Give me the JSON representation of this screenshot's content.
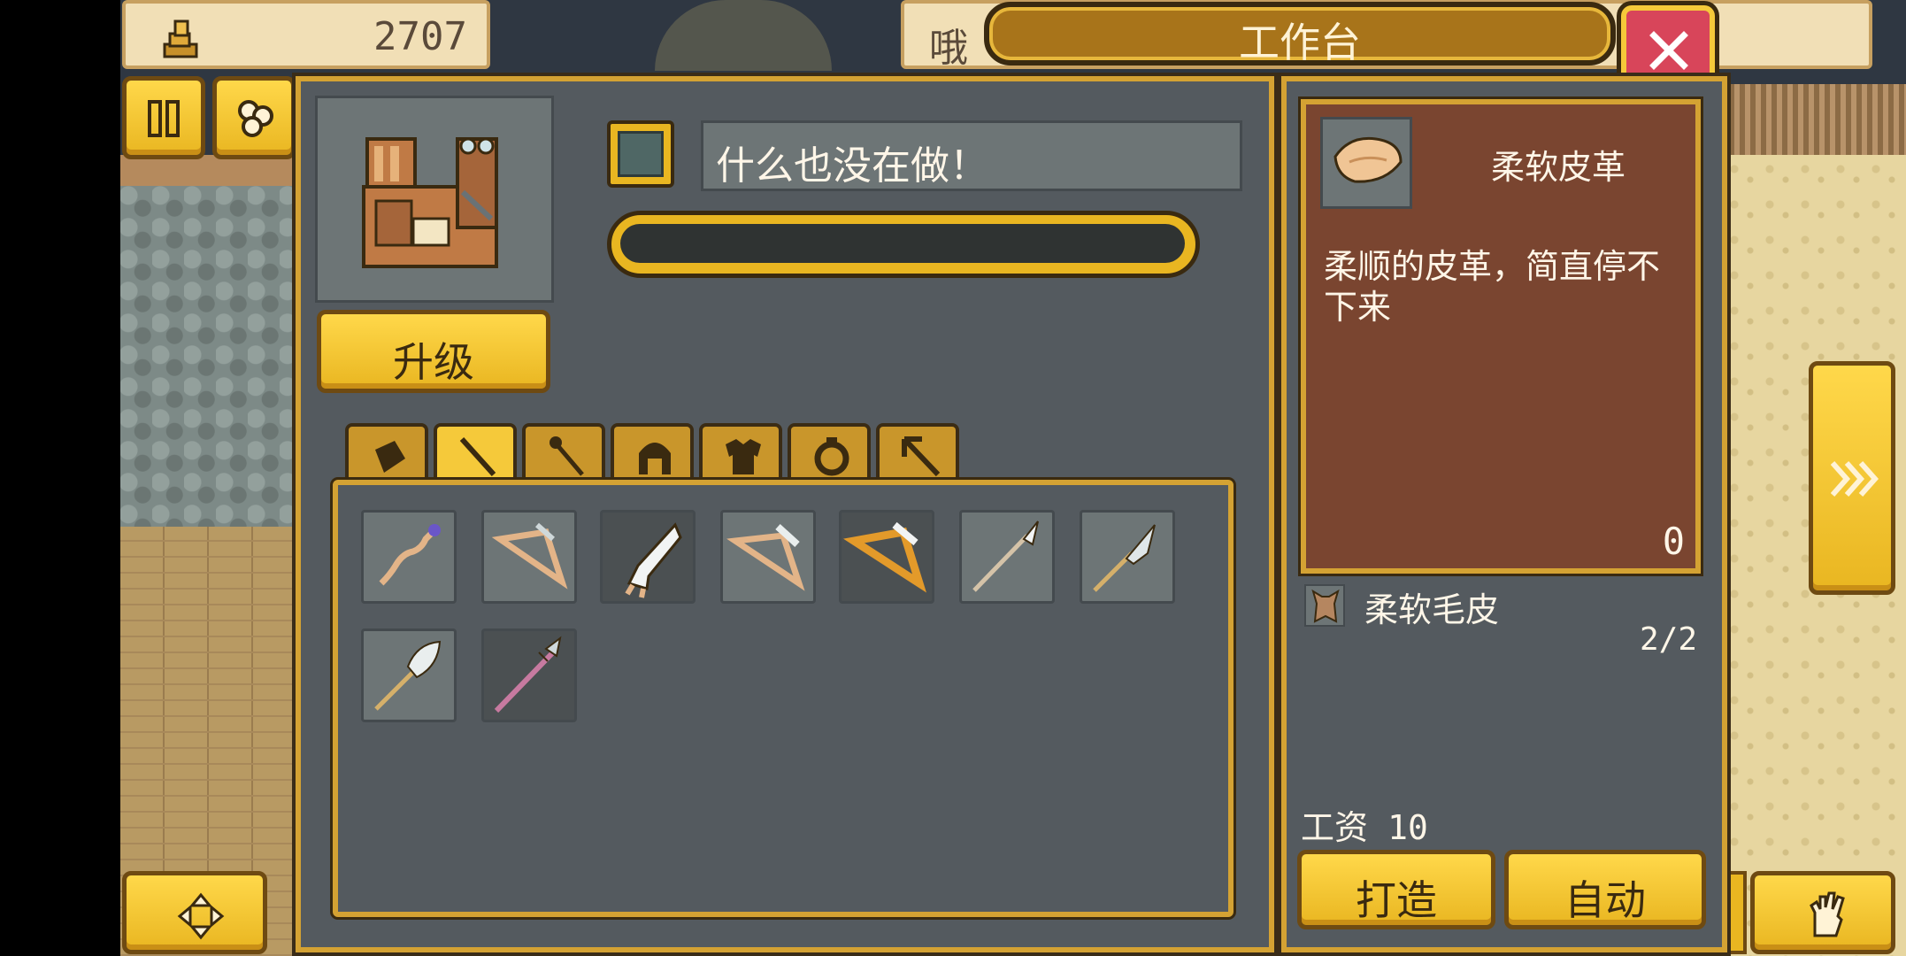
{
  "header": {
    "coins": "2707",
    "partial_label": "哦",
    "title": "工作台"
  },
  "workbench": {
    "status_text": "什么也没在做！",
    "progress": 0,
    "upgrade_label": "升级"
  },
  "tabs": [
    {
      "icon": "material-icon",
      "active": false
    },
    {
      "icon": "staff-icon",
      "active": true
    },
    {
      "icon": "wand-icon",
      "active": false
    },
    {
      "icon": "helmet-icon",
      "active": false
    },
    {
      "icon": "armor-icon",
      "active": false
    },
    {
      "icon": "ring-icon",
      "active": false
    },
    {
      "icon": "pickaxe-icon",
      "active": false
    }
  ],
  "recipes": [
    {
      "icon": "twisted-staff-icon"
    },
    {
      "icon": "bow-icon"
    },
    {
      "icon": "claw-blade-icon"
    },
    {
      "icon": "bow-icon"
    },
    {
      "icon": "golden-bow-icon"
    },
    {
      "icon": "spear-icon"
    },
    {
      "icon": "glaive-icon"
    },
    {
      "icon": "shovel-spear-icon"
    },
    {
      "icon": "halberd-icon"
    }
  ],
  "detail": {
    "item_name": "柔软皮革",
    "description": "柔顺的皮革，简直停不下来",
    "owned_count": "0",
    "ingredient_name": "柔软毛皮",
    "ingredient_count": "2/2",
    "wage_label": "工资",
    "wage_value": "10",
    "craft_label": "打造",
    "auto_label": "自动"
  },
  "colors": {
    "gold": "#f5c93a",
    "panel": "#545a5f",
    "detail_bg": "#7a4530",
    "close_red": "#d8455a"
  }
}
